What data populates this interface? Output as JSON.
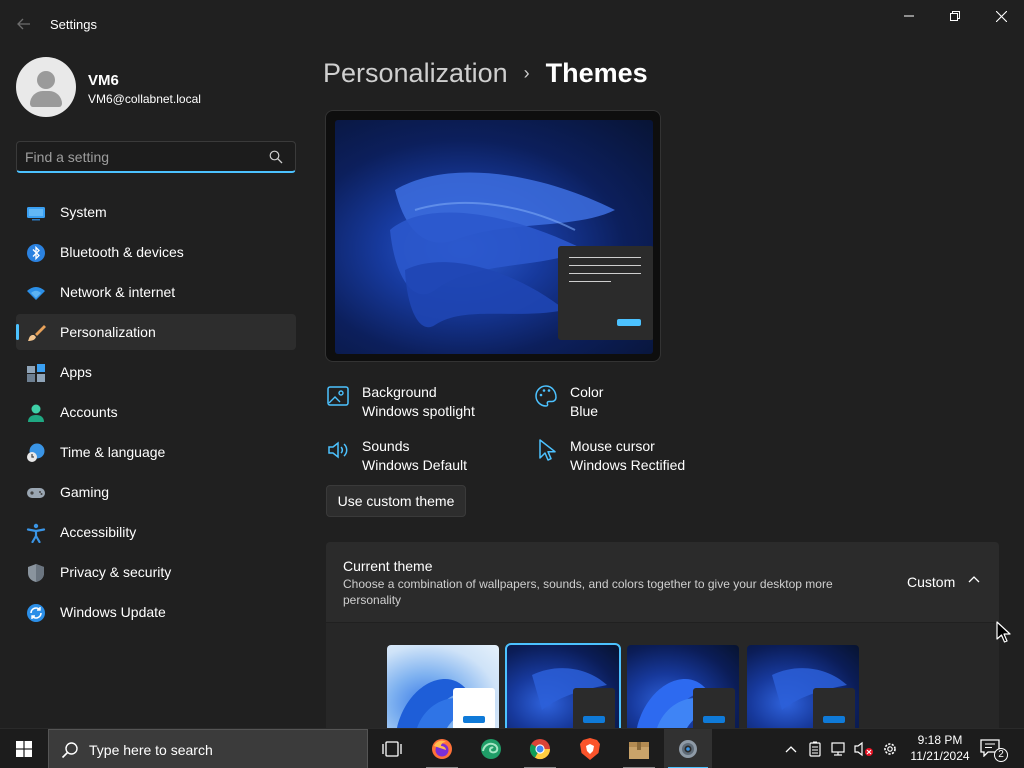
{
  "window": {
    "title": "Settings",
    "back_icon": "back-arrow-icon",
    "controls": [
      "minimize-icon",
      "restore-icon",
      "close-icon"
    ]
  },
  "profile": {
    "name": "VM6",
    "email": "VM6@collabnet.local"
  },
  "search": {
    "placeholder": "Find a setting",
    "value": ""
  },
  "sidebar": {
    "items": [
      {
        "label": "System",
        "icon": "system-display-icon",
        "active": false
      },
      {
        "label": "Bluetooth & devices",
        "icon": "bluetooth-icon",
        "active": false
      },
      {
        "label": "Network & internet",
        "icon": "wifi-icon",
        "active": false
      },
      {
        "label": "Personalization",
        "icon": "paintbrush-icon",
        "active": true
      },
      {
        "label": "Apps",
        "icon": "apps-icon",
        "active": false
      },
      {
        "label": "Accounts",
        "icon": "account-icon",
        "active": false
      },
      {
        "label": "Time & language",
        "icon": "clock-globe-icon",
        "active": false
      },
      {
        "label": "Gaming",
        "icon": "gamepad-icon",
        "active": false
      },
      {
        "label": "Accessibility",
        "icon": "accessibility-icon",
        "active": false
      },
      {
        "label": "Privacy & security",
        "icon": "shield-icon",
        "active": false
      },
      {
        "label": "Windows Update",
        "icon": "update-icon",
        "active": false
      }
    ]
  },
  "main": {
    "breadcrumb": {
      "parent": "Personalization",
      "separator": "›",
      "current": "Themes"
    },
    "properties": [
      {
        "label": "Background",
        "value": "Windows spotlight",
        "icon": "image-icon"
      },
      {
        "label": "Color",
        "value": "Blue",
        "icon": "palette-icon"
      },
      {
        "label": "Sounds",
        "value": "Windows Default",
        "icon": "speaker-icon"
      },
      {
        "label": "Mouse cursor",
        "value": "Windows Rectified",
        "icon": "cursor-icon"
      }
    ],
    "custom_theme_button": "Use custom theme",
    "current_theme": {
      "title": "Current theme",
      "description": "Choose a combination of wallpapers, sounds, and colors together to give your desktop more personality",
      "value": "Custom",
      "expanded": true
    },
    "themes": [
      {
        "style": "light",
        "selected": false
      },
      {
        "style": "dark",
        "selected": true
      },
      {
        "style": "dark",
        "selected": false
      },
      {
        "style": "dark",
        "selected": false
      }
    ]
  },
  "taskbar": {
    "search_placeholder": "Type here to search",
    "apps": [
      "task-view-icon",
      "firefox-icon",
      "edge-beta-icon",
      "chrome-icon",
      "brave-icon",
      "package-icon",
      "settings-gear-icon"
    ],
    "tray_icons": [
      "chevron-up-icon",
      "battery-icon",
      "network-icon",
      "volume-muted-icon",
      "gear-icon"
    ],
    "time": "9:18 PM",
    "date": "11/21/2024",
    "notification_count": "2"
  },
  "colors": {
    "background": "#202020",
    "accent": "#4cc2ff",
    "card": "#2b2b2b",
    "taskbar": "#1c1c1c"
  }
}
